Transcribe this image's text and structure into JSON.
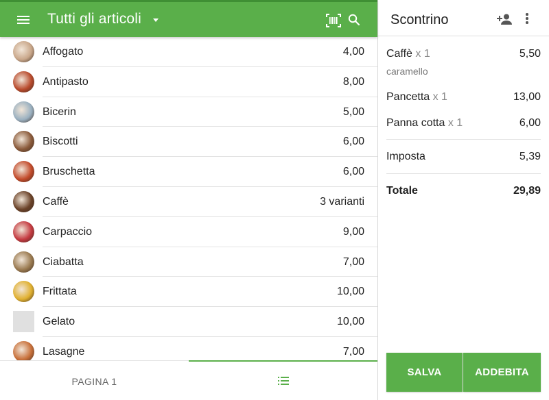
{
  "header": {
    "title": "Tutti gli articoli",
    "accent_color": "#5aaf4a",
    "icons": [
      "menu-icon",
      "dropdown-caret-icon",
      "barcode-scan-icon",
      "search-icon"
    ]
  },
  "items": [
    {
      "name": "Affogato",
      "price": "4,00",
      "thumb_color": "#c9a78a"
    },
    {
      "name": "Antipasto",
      "price": "8,00",
      "thumb_color": "#b84a2c"
    },
    {
      "name": "Bicerin",
      "price": "5,00",
      "thumb_color": "#9ab0c0"
    },
    {
      "name": "Biscotti",
      "price": "6,00",
      "thumb_color": "#8a5a3a"
    },
    {
      "name": "Bruschetta",
      "price": "6,00",
      "thumb_color": "#c24a2a"
    },
    {
      "name": "Caffè",
      "price": "3 varianti",
      "thumb_color": "#6a4228"
    },
    {
      "name": "Carpaccio",
      "price": "9,00",
      "thumb_color": "#c43a40"
    },
    {
      "name": "Ciabatta",
      "price": "7,00",
      "thumb_color": "#9a7a50"
    },
    {
      "name": "Frittata",
      "price": "10,00",
      "thumb_color": "#e0b030"
    },
    {
      "name": "Gelato",
      "price": "10,00",
      "thumb_color": "#e0e0e0",
      "square": true
    },
    {
      "name": "Lasagne",
      "price": "7,00",
      "thumb_color": "#c8703a"
    }
  ],
  "tabs": {
    "page_label": "PAGINA 1",
    "list_icon": "list-icon"
  },
  "receipt": {
    "title": "Scontrino",
    "icons": [
      "add-customer-icon",
      "more-vert-icon"
    ],
    "lines": [
      {
        "name": "Caffè",
        "qty": "x 1",
        "price": "5,50",
        "modifier": "caramello"
      },
      {
        "name": "Pancetta",
        "qty": "x 1",
        "price": "13,00"
      },
      {
        "name": "Panna cotta",
        "qty": "x 1",
        "price": "6,00"
      }
    ],
    "tax_label": "Imposta",
    "tax_value": "5,39",
    "total_label": "Totale",
    "total_value": "29,89",
    "save_label": "SALVA",
    "charge_label": "ADDEBITA"
  }
}
